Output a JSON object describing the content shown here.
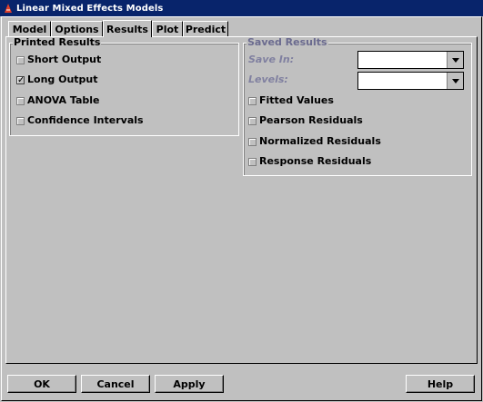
{
  "window": {
    "title": "Linear Mixed Effects Models"
  },
  "tabs": [
    {
      "label": "Model"
    },
    {
      "label": "Options"
    },
    {
      "label": "Results"
    },
    {
      "label": "Plot"
    },
    {
      "label": "Predict"
    }
  ],
  "printed_results": {
    "legend": "Printed Results",
    "options": [
      {
        "label": "Short Output",
        "checked": false
      },
      {
        "label": "Long Output",
        "checked": true
      },
      {
        "label": "ANOVA Table",
        "checked": false
      },
      {
        "label": "Confidence Intervals",
        "checked": false
      }
    ]
  },
  "saved_results": {
    "legend": "Saved Results",
    "save_in_label": "Save In:",
    "save_in_value": "",
    "levels_label": "Levels:",
    "levels_value": "",
    "options": [
      {
        "label": "Fitted Values",
        "checked": false
      },
      {
        "label": "Pearson Residuals",
        "checked": false
      },
      {
        "label": "Normalized Residuals",
        "checked": false
      },
      {
        "label": "Response Residuals",
        "checked": false
      }
    ]
  },
  "buttons": {
    "ok": "OK",
    "cancel": "Cancel",
    "apply": "Apply",
    "help": "Help"
  },
  "icons": {
    "app": "app-icon",
    "dropdown": "chevron-down-icon",
    "check": "checkmark-icon"
  }
}
